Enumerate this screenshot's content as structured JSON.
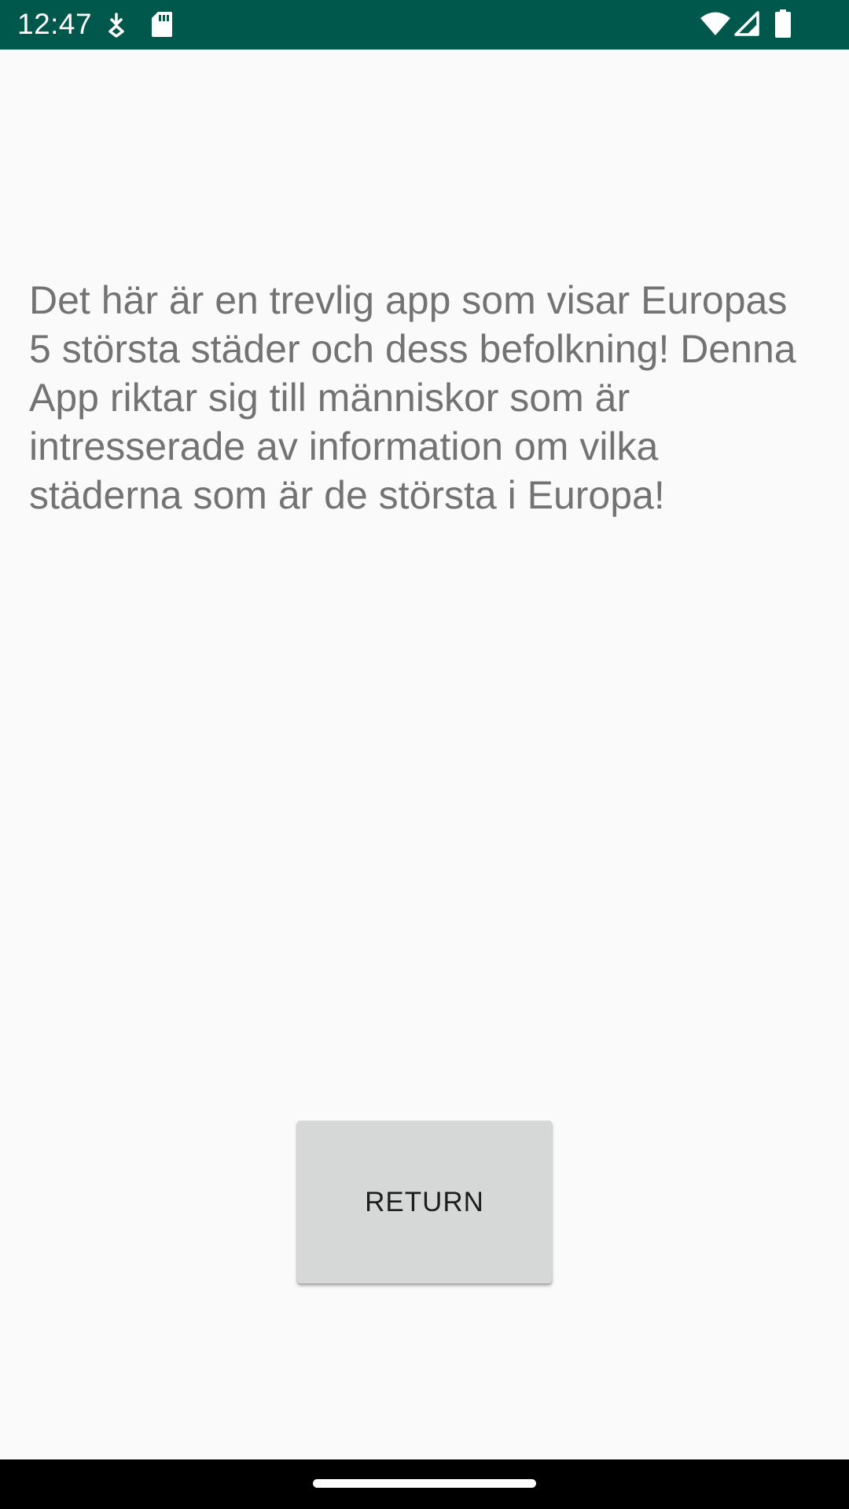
{
  "status_bar": {
    "time": "12:47",
    "icons": [
      "download-icon",
      "sd-card-icon",
      "wifi-icon",
      "cellular-signal-icon",
      "battery-icon"
    ]
  },
  "main": {
    "description": "Det här är en trevlig app som visar Europas 5 största städer och dess befolkning! Denna App riktar sig till människor som är intresserade av information om vilka städerna som är de största i Europa!",
    "return_label": "RETURN"
  },
  "colors": {
    "status_bar": "#00574b",
    "background": "#fafafa",
    "text": "#737373",
    "button": "#d6d7d7"
  }
}
